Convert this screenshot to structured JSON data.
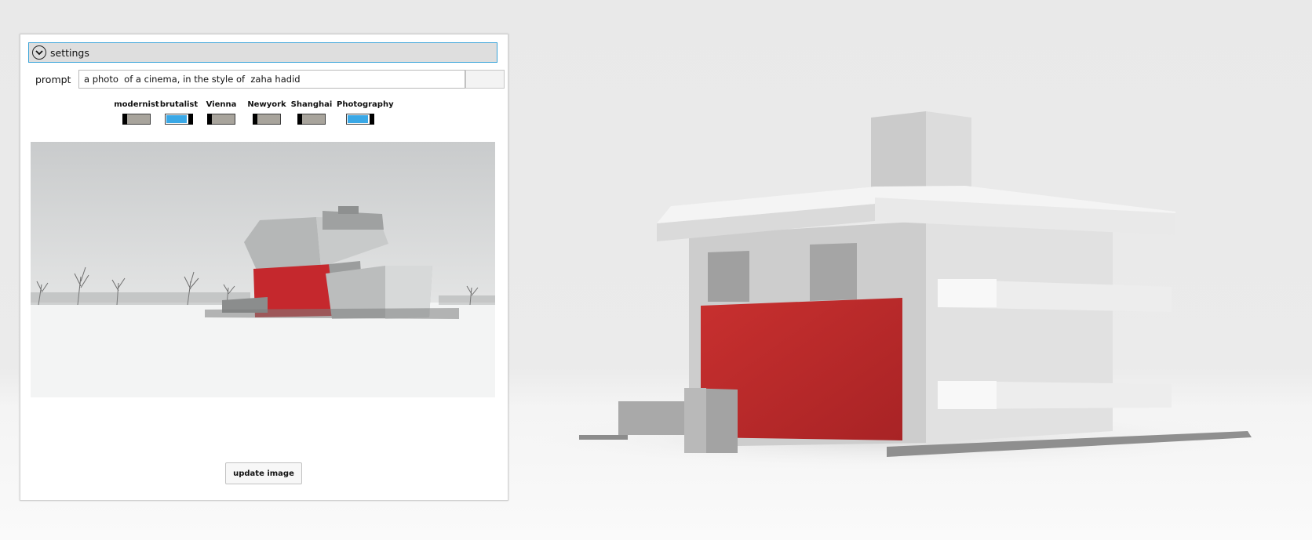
{
  "panel": {
    "title": "settings",
    "prompt_label": "prompt",
    "prompt_value": "a photo  of a cinema, in the style of  zaha hadid",
    "toggles": [
      {
        "label": "modernist",
        "state": "off"
      },
      {
        "label": "brutalist",
        "state": "on"
      },
      {
        "label": "Vienna",
        "state": "off"
      },
      {
        "label": "Newyork",
        "state": "off"
      },
      {
        "label": "Shanghai",
        "state": "off"
      },
      {
        "label": "Photography",
        "state": "on"
      }
    ],
    "update_label": "update image"
  },
  "colors": {
    "accent": "#3aa8e6",
    "header_border": "#3aa3d8",
    "facade_red": "#c42d30",
    "switch_off": "#a8a49c"
  },
  "icons": {
    "header_toggle": "chevron-down-icon"
  }
}
